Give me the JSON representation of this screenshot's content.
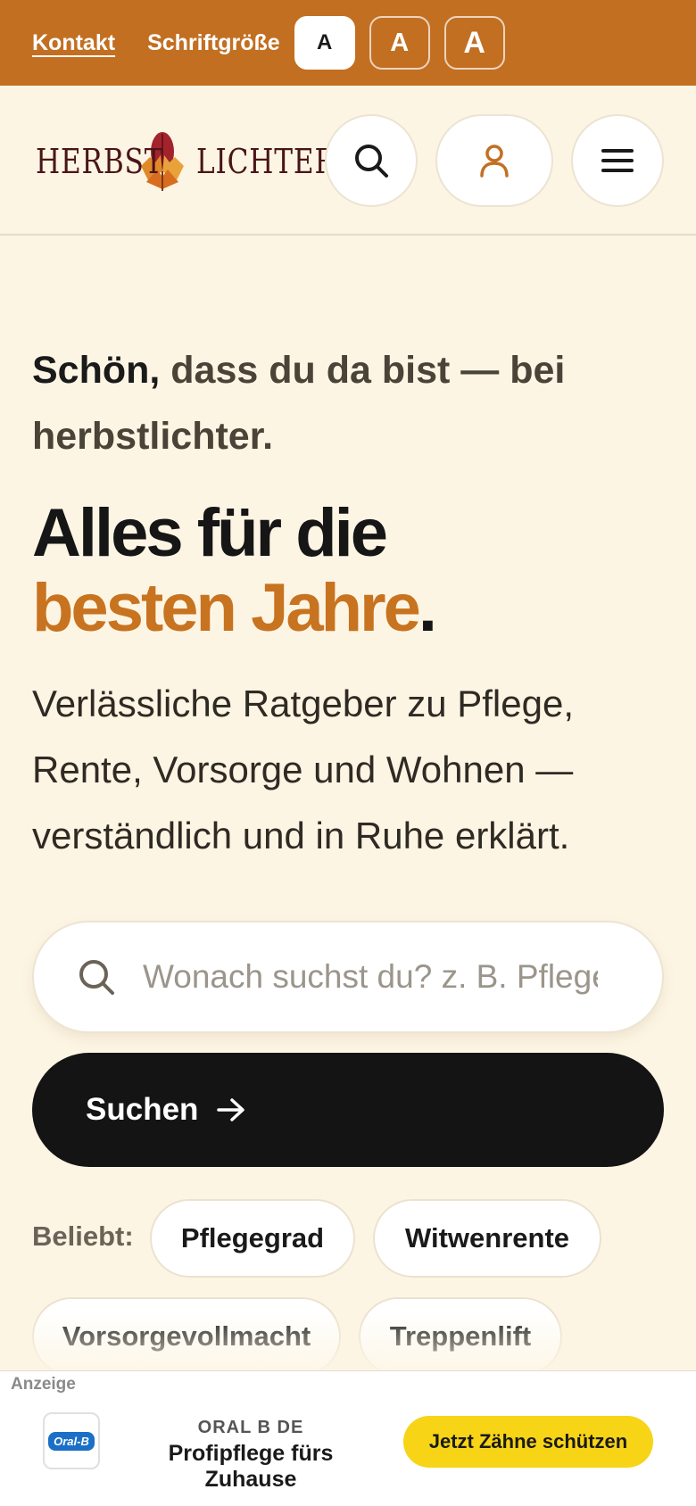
{
  "topbar": {
    "contact_label": "Kontakt",
    "font_size_label": "Schriftgröße",
    "font_size_options": [
      "A",
      "A",
      "A"
    ],
    "active_option": 0,
    "background": "#c26f22"
  },
  "header": {
    "logo_left": "HERBST",
    "logo_right": "LICHTER",
    "search_icon": "search-icon",
    "account_icon": "user-icon",
    "menu_icon": "hamburger-menu-icon"
  },
  "hero": {
    "greeting_strong": "Schön,",
    "greeting_rest": " dass du da bist — bei herbstlichter.",
    "headline_line1": "Alles für die",
    "headline_accent": "besten Jahre",
    "headline_period": ".",
    "lead": "Verlässliche Ratgeber zu Pflege, Rente, Vorsorge und Wohnen — verständlich und in Ruhe erklärt.",
    "accent_color": "#c8731f"
  },
  "search": {
    "placeholder": "Wonach suchst du? z. B. Pflegegrad",
    "value": "",
    "button_label": "Suchen"
  },
  "popular": {
    "label": "Beliebt:",
    "chips": [
      "Pflegegrad",
      "Witwenrente",
      "Vorsorgevollmacht",
      "Treppenlift"
    ]
  },
  "ad": {
    "label": "Anzeige",
    "logo_text": "Oral-B",
    "brand": "ORAL B DE",
    "tagline": "Profipflege fürs Zuhause",
    "cta": "Jetzt Zähne schützen",
    "cta_color": "#f7d416"
  }
}
